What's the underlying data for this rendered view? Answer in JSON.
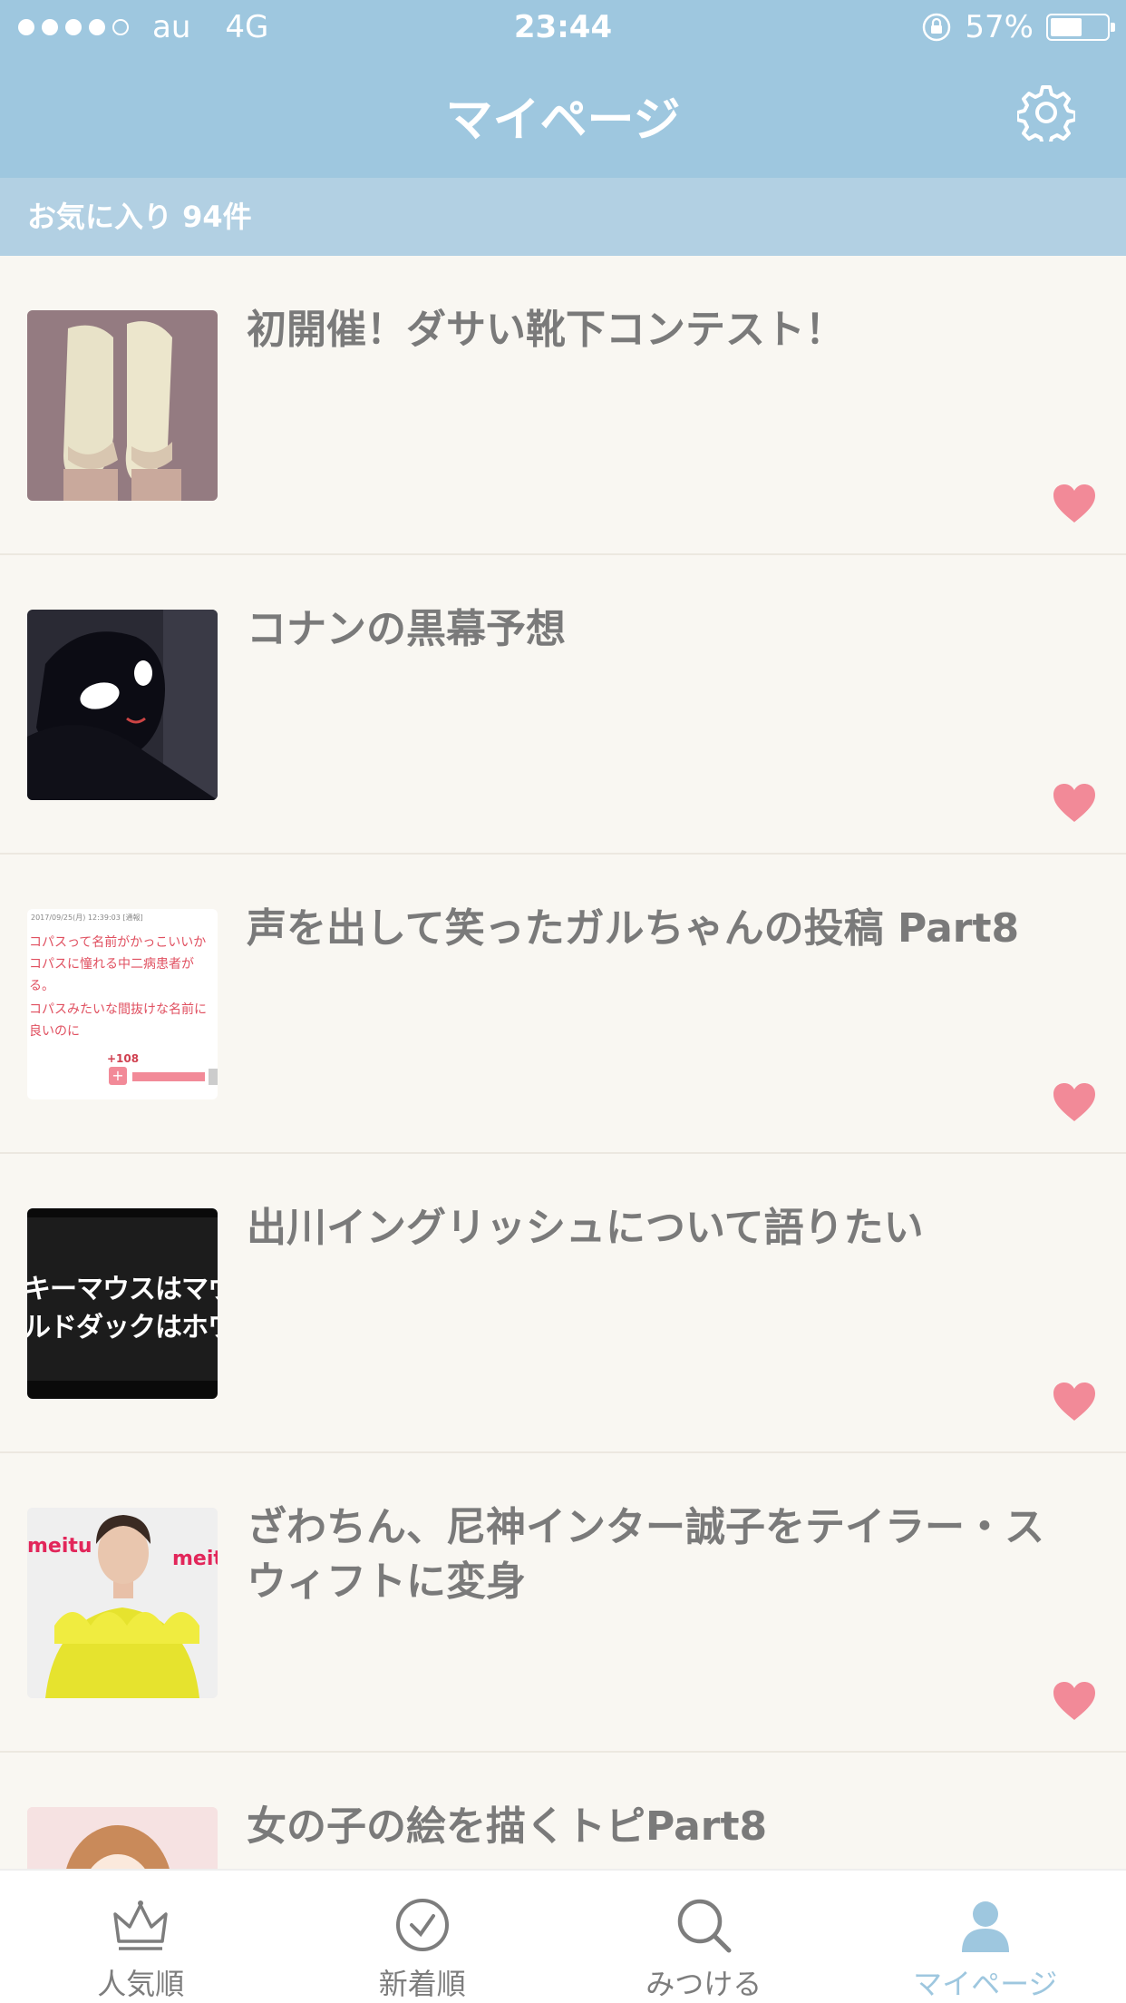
{
  "status": {
    "carrier": "au",
    "network": "4G",
    "time": "23:44",
    "battery": "57%",
    "battery_level": 0.57,
    "signal_bars": 4
  },
  "nav": {
    "title": "マイページ",
    "settings_icon": "gear-icon"
  },
  "subheader": {
    "label": "お気に入り 94件"
  },
  "colors": {
    "header": "#9ec7df",
    "subheader": "#b2d0e3",
    "heart": "#f28a98",
    "background": "#f9f7f2"
  },
  "items": [
    {
      "title": "初開催！ダサい靴下コンテスト！",
      "thumb": "socks-photo"
    },
    {
      "title": "コナンの黒幕予想",
      "thumb": "anime-silhouette"
    },
    {
      "title": "声を出して笑ったガルちゃんの投稿 Part8",
      "thumb": "text-post-screenshot"
    },
    {
      "title": "出川イングリッシュについて語りたい",
      "thumb": "tv-caption-screenshot"
    },
    {
      "title": "ざわちん、尼神インター誠子をテイラー・スウィフトに変身",
      "thumb": "woman-yellow-dress"
    },
    {
      "title": "女の子の絵を描くトピPart8",
      "thumb": "girl-illustration"
    }
  ],
  "thumb_text": {
    "post_date": "2017/09/25(月) 12:39:03 [通報]",
    "post_lines": [
      "コパスって名前がかっこいいか",
      "コパスに憧れる中二病患者が",
      "る。",
      "コパスみたいな間抜けな名前に",
      "良いのに"
    ],
    "post_votes": "+108",
    "tv_line1": "キーマウスはマウ",
    "tv_line2": "ルドダックはホワ",
    "brand": "meitu"
  },
  "tabs": [
    {
      "label": "人気順",
      "icon": "crown-icon",
      "active": false
    },
    {
      "label": "新着順",
      "icon": "clock-icon",
      "active": false
    },
    {
      "label": "みつける",
      "icon": "search-icon",
      "active": false
    },
    {
      "label": "マイページ",
      "icon": "person-icon",
      "active": true
    }
  ]
}
